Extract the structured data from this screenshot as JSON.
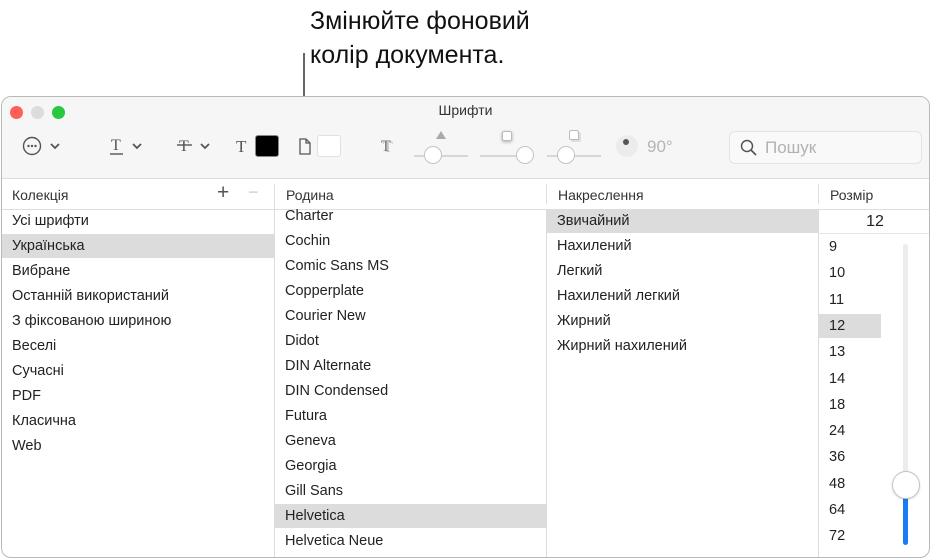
{
  "callout": {
    "line1": "Змінюйте фоновий",
    "line2": "колір документа."
  },
  "window": {
    "title": "Шрифти"
  },
  "toolbar": {
    "actions_icon": "ellipsis-circle-icon",
    "rotation_value": "90°",
    "text_color": "#000000",
    "document_color": "#ffffff",
    "search_placeholder": "Пошук"
  },
  "headers": {
    "collection": "Колекція",
    "add": "+",
    "remove": "−",
    "family": "Родина",
    "typeface": "Накреслення",
    "size": "Розмір"
  },
  "collections": [
    {
      "label": "Усі шрифти",
      "selected": false
    },
    {
      "label": "Українська",
      "selected": true
    },
    {
      "label": "Вибране",
      "selected": false
    },
    {
      "label": "Останній використаний",
      "selected": false
    },
    {
      "label": "З фіксованою шириною",
      "selected": false
    },
    {
      "label": "Веселі",
      "selected": false
    },
    {
      "label": "Сучасні",
      "selected": false
    },
    {
      "label": "PDF",
      "selected": false
    },
    {
      "label": "Класична",
      "selected": false
    },
    {
      "label": "Web",
      "selected": false
    }
  ],
  "families": [
    {
      "label": "Charter",
      "selected": false
    },
    {
      "label": "Cochin",
      "selected": false
    },
    {
      "label": "Comic Sans MS",
      "selected": false
    },
    {
      "label": "Copperplate",
      "selected": false
    },
    {
      "label": "Courier New",
      "selected": false
    },
    {
      "label": "Didot",
      "selected": false
    },
    {
      "label": "DIN Alternate",
      "selected": false
    },
    {
      "label": "DIN Condensed",
      "selected": false
    },
    {
      "label": "Futura",
      "selected": false
    },
    {
      "label": "Geneva",
      "selected": false
    },
    {
      "label": "Georgia",
      "selected": false
    },
    {
      "label": "Gill Sans",
      "selected": false
    },
    {
      "label": "Helvetica",
      "selected": true
    },
    {
      "label": "Helvetica Neue",
      "selected": false
    }
  ],
  "typefaces": [
    {
      "label": "Звичайний",
      "selected": true
    },
    {
      "label": "Нахилений",
      "selected": false
    },
    {
      "label": "Легкий",
      "selected": false
    },
    {
      "label": "Нахилений легкий",
      "selected": false
    },
    {
      "label": "Жирний",
      "selected": false
    },
    {
      "label": "Жирний нахилений",
      "selected": false
    }
  ],
  "size": {
    "current": "12",
    "options": [
      {
        "label": "9",
        "selected": false
      },
      {
        "label": "10",
        "selected": false
      },
      {
        "label": "11",
        "selected": false
      },
      {
        "label": "12",
        "selected": true
      },
      {
        "label": "13",
        "selected": false
      },
      {
        "label": "14",
        "selected": false
      },
      {
        "label": "18",
        "selected": false
      },
      {
        "label": "24",
        "selected": false
      },
      {
        "label": "36",
        "selected": false
      },
      {
        "label": "48",
        "selected": false
      },
      {
        "label": "64",
        "selected": false
      },
      {
        "label": "72",
        "selected": false
      }
    ],
    "slider_fraction": 0.2
  }
}
